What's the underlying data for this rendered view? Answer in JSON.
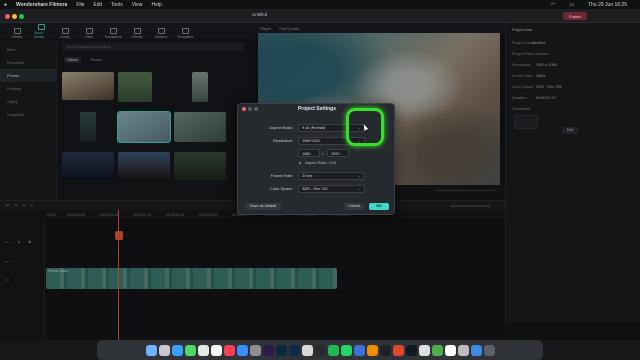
{
  "menubar": {
    "app": "Wondershare Filmora",
    "items": [
      "File",
      "Edit",
      "Tools",
      "View",
      "Help"
    ],
    "clock": "Thu 29 Jun 16:25"
  },
  "titlebar": {
    "project": "Untitled",
    "export": "Export"
  },
  "toolbar": {
    "items": [
      "Media",
      "Stock Media",
      "Audio",
      "Titles",
      "Transitions",
      "Effects",
      "Stickers",
      "Templates"
    ],
    "active_index": 1
  },
  "library": {
    "sidebar": [
      "Mine",
      "Recorded",
      "Pexels",
      "Pixabay",
      "Giphy",
      "Unsplash"
    ],
    "selected_index": 2,
    "search_placeholder": "Search images and videos",
    "chips": [
      "Videos",
      "Photos"
    ]
  },
  "preview": {
    "tabs": [
      "Player",
      "Full Quality"
    ]
  },
  "right_panel": {
    "title": "Project Info",
    "rows": [
      {
        "label": "Project Name:",
        "value": "Untitled"
      },
      {
        "label": "Project Files Location:",
        "value": "-"
      },
      {
        "label": "Resolution:",
        "value": "1920 x 1080"
      },
      {
        "label": "Frame Rate:",
        "value": "25fps"
      },
      {
        "label": "Color Space:",
        "value": "SDR - Rec.709"
      },
      {
        "label": "Duration:",
        "value": "00:00:07:07"
      },
      {
        "label": "Thumbnail:",
        "value": ""
      }
    ],
    "edit_button": "Edit"
  },
  "timeline": {
    "ruler": [
      "00:00",
      "00:00:04:20",
      "00:00:09:16",
      "00:00:14:12",
      "00:00:19:08",
      "00:00:24:04",
      "00:00:29:00",
      "00:00:33:20",
      "00:00:38:16",
      "00:00:43:12"
    ],
    "clip_title": "Pexels Video"
  },
  "dialog": {
    "title": "Project Settings",
    "aspect_ratio_label": "Aspect Ratio:",
    "aspect_ratio_value": "9:16 (Portrait)",
    "resolution_label": "Resolution:",
    "resolution_value": "1080*1920",
    "width": "1080",
    "times": "x",
    "height": "1920",
    "aspect_note": "Aspect Ratio: 9:16",
    "frame_rate_label": "Frame Rate:",
    "frame_rate_value": "24 fps",
    "color_space_label": "Color Space:",
    "color_space_value": "SDR - Rec.709",
    "save_default": "Save as default",
    "cancel": "Cancel",
    "ok": "OK"
  },
  "colors": {
    "accent": "#3fd7c7",
    "highlight_ring": "#37e02b",
    "playhead": "#e65a3a",
    "ok_button": "#3fd7c7"
  }
}
